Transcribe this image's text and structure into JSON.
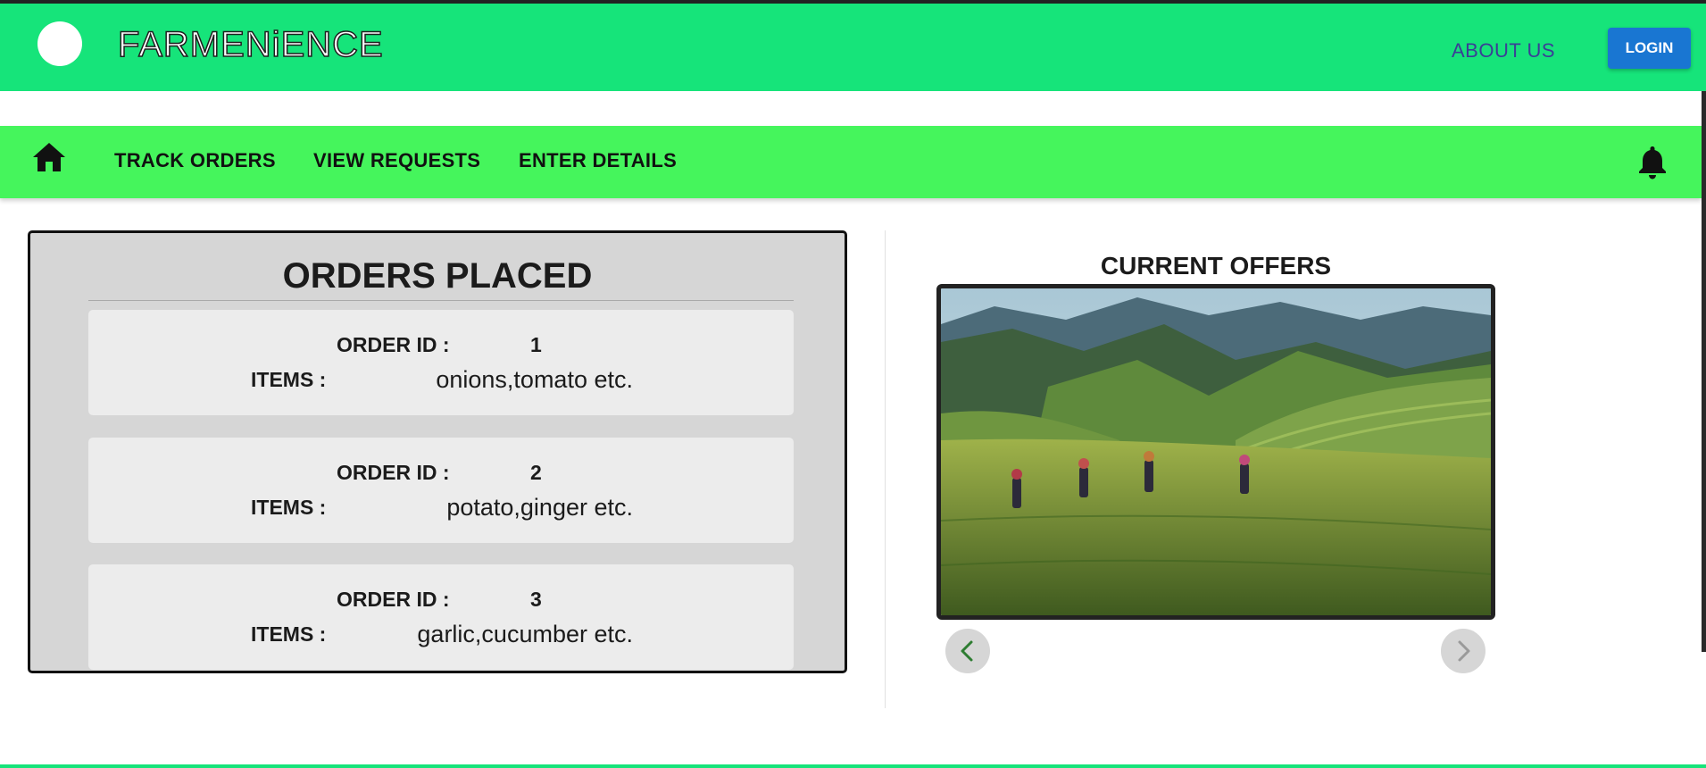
{
  "header": {
    "brand": "FARMENiENCE",
    "about_label": "ABOUT US",
    "login_label": "LOGIN",
    "logo_icon": "circle-logo-icon"
  },
  "navbar": {
    "home_icon": "home-icon",
    "items": [
      {
        "label": "TRACK ORDERS"
      },
      {
        "label": "VIEW REQUESTS"
      },
      {
        "label": "ENTER DETAILS"
      }
    ],
    "notification_icon": "bell-icon"
  },
  "orders": {
    "title": "ORDERS PLACED",
    "order_id_label": "ORDER ID :",
    "items_label": "ITEMS :",
    "list": [
      {
        "id": "1",
        "items": "onions,tomato etc."
      },
      {
        "id": "2",
        "items": "potato,ginger etc."
      },
      {
        "id": "3",
        "items": "garlic,cucumber etc."
      }
    ]
  },
  "offers": {
    "title": "CURRENT OFFERS",
    "prev_icon": "chevron-left-icon",
    "next_icon": "chevron-right-icon"
  },
  "colors": {
    "header_bg": "#16e47a",
    "navbar_bg": "#45f55c",
    "login_bg": "#1976d2",
    "about_text": "#3a3f96",
    "panel_bg": "#d6d6d6",
    "card_bg": "#ececec"
  }
}
